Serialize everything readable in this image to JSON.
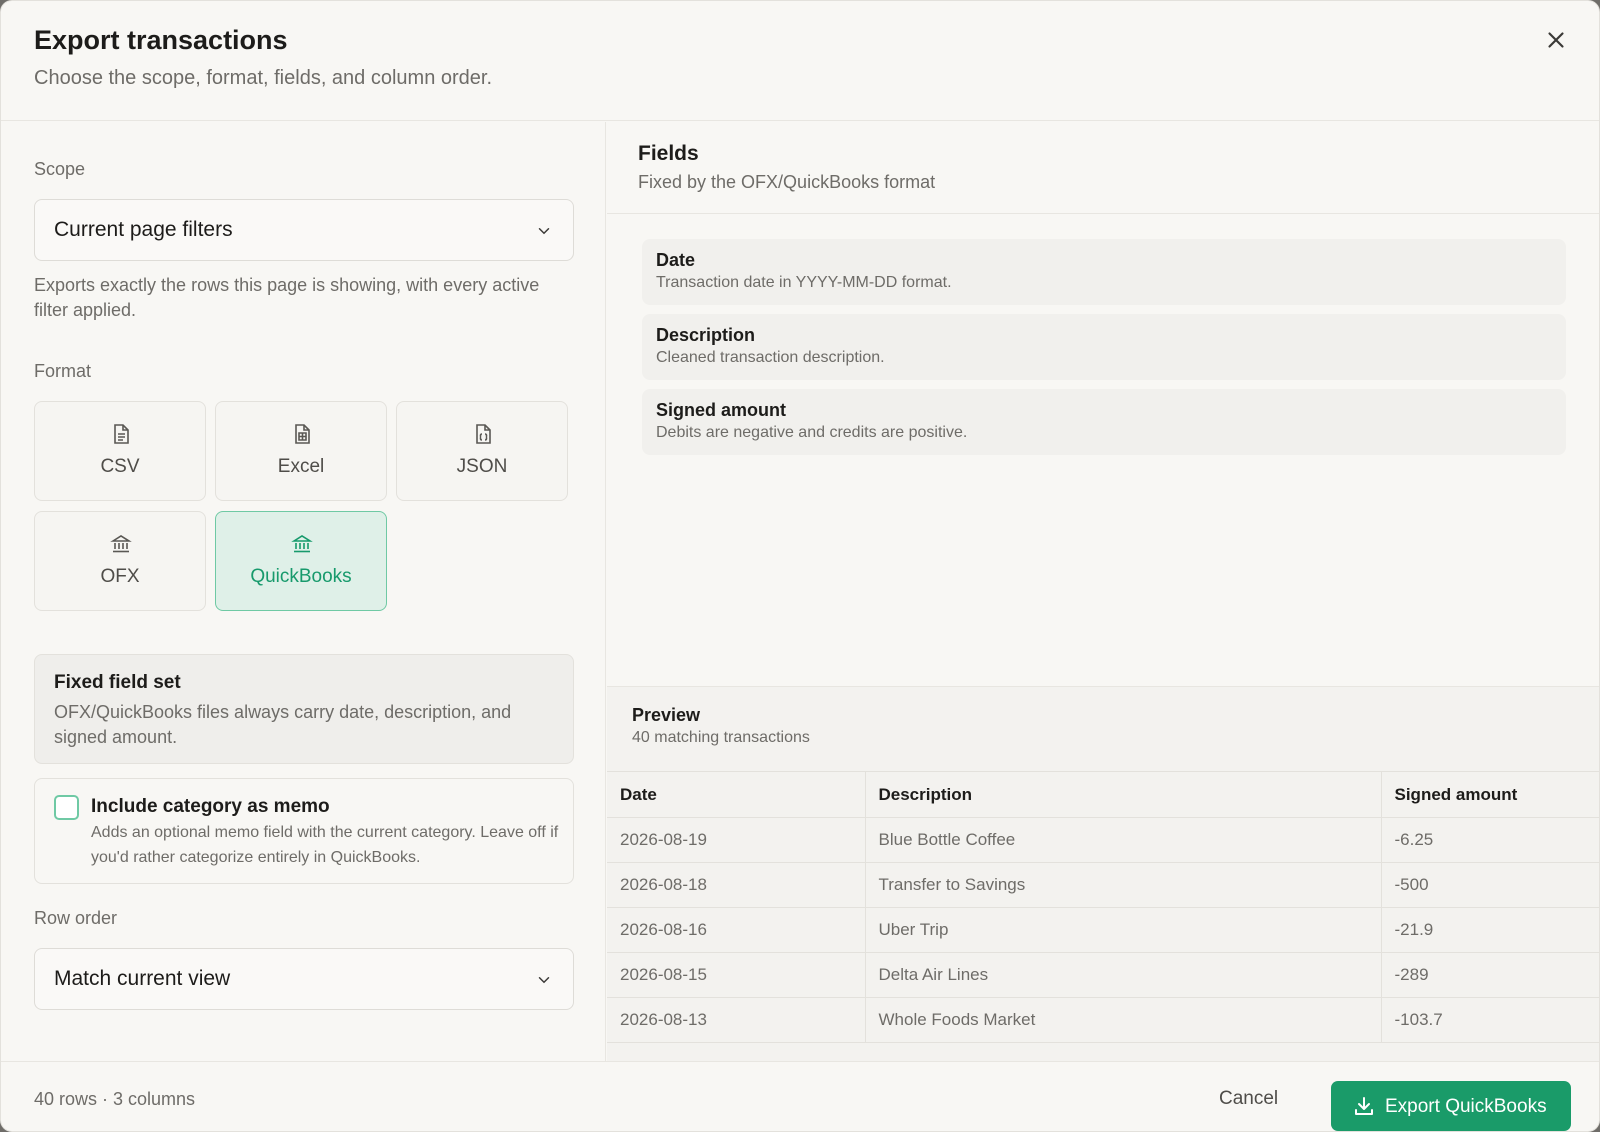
{
  "dialog": {
    "title": "Export transactions",
    "subtitle": "Choose the scope, format, fields, and column order.",
    "close_icon": "close-icon"
  },
  "scope": {
    "label": "Scope",
    "value": "Current page filters",
    "help": "Exports exactly the rows this page is showing, with every active filter applied."
  },
  "format": {
    "label": "Format",
    "options": [
      {
        "label": "CSV",
        "icon": "file-text-icon",
        "selected": false
      },
      {
        "label": "Excel",
        "icon": "spreadsheet-icon",
        "selected": false
      },
      {
        "label": "JSON",
        "icon": "json-file-icon",
        "selected": false
      },
      {
        "label": "OFX",
        "icon": "bank-icon",
        "selected": false
      },
      {
        "label": "QuickBooks",
        "icon": "bank-icon",
        "selected": true
      }
    ]
  },
  "fixed_set": {
    "title": "Fixed field set",
    "description": "OFX/QuickBooks files always carry date, description, and signed amount."
  },
  "memo": {
    "label": "Include category as memo",
    "description": "Adds an optional memo field with the current category. Leave off if you'd rather categorize entirely in QuickBooks.",
    "checked": false
  },
  "row_order": {
    "label": "Row order",
    "value": "Match current view"
  },
  "fields": {
    "title": "Fields",
    "subtitle": "Fixed by the OFX/QuickBooks format",
    "items": [
      {
        "name": "Date",
        "description": "Transaction date in YYYY-MM-DD format."
      },
      {
        "name": "Description",
        "description": "Cleaned transaction description."
      },
      {
        "name": "Signed amount",
        "description": "Debits are negative and credits are positive."
      }
    ]
  },
  "preview": {
    "title": "Preview",
    "subtitle": "40 matching transactions",
    "columns": [
      "Date",
      "Description",
      "Signed amount"
    ],
    "rows": [
      [
        "2026-08-19",
        "Blue Bottle Coffee",
        "-6.25"
      ],
      [
        "2026-08-18",
        "Transfer to Savings",
        "-500"
      ],
      [
        "2026-08-16",
        "Uber Trip",
        "-21.9"
      ],
      [
        "2026-08-15",
        "Delta Air Lines",
        "-289"
      ],
      [
        "2026-08-13",
        "Whole Foods Market",
        "-103.7"
      ]
    ]
  },
  "footer": {
    "summary": "40 rows · 3 columns",
    "cancel_label": "Cancel",
    "export_label": "Export QuickBooks",
    "export_icon": "download-icon"
  },
  "colors": {
    "accent": "#1a9b69",
    "selected_bg": "#dff0e8",
    "selected_border": "#6fc9a4"
  }
}
